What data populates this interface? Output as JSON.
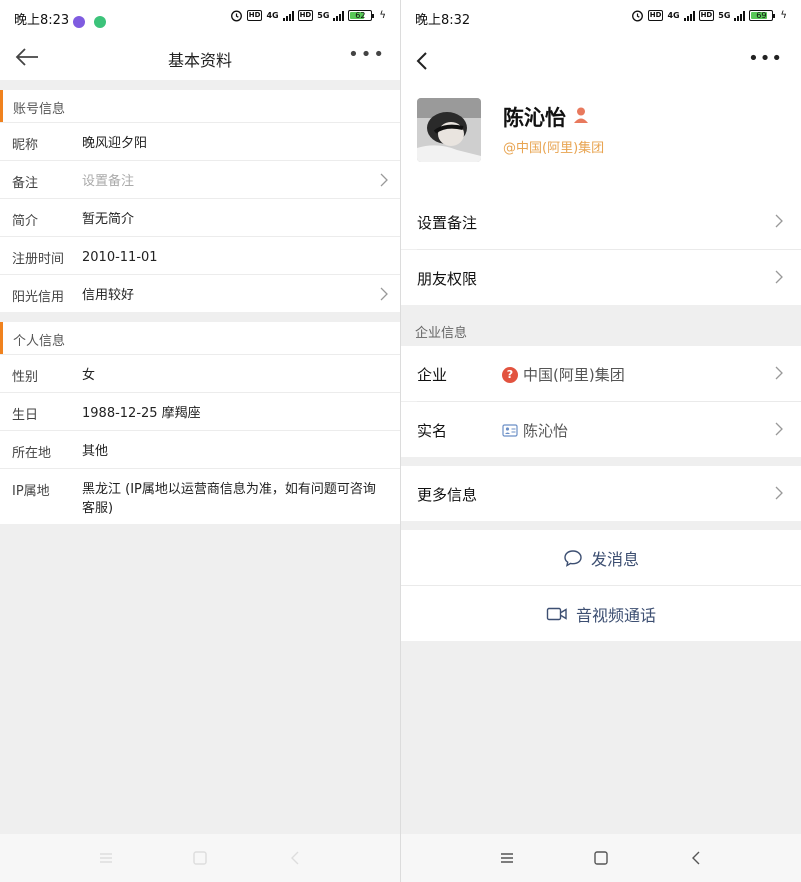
{
  "left": {
    "status": {
      "time": "晚上8:23",
      "battery": "62"
    },
    "header": {
      "title": "基本资料"
    },
    "account_section": {
      "title": "账号信息",
      "rows": [
        {
          "label": "昵称",
          "value": "晚风迎夕阳"
        },
        {
          "label": "备注",
          "value": "设置备注"
        },
        {
          "label": "简介",
          "value": "暂无简介"
        },
        {
          "label": "注册时间",
          "value": "2010-11-01"
        },
        {
          "label": "阳光信用",
          "value": "信用较好"
        }
      ]
    },
    "personal_section": {
      "title": "个人信息",
      "rows": [
        {
          "label": "性别",
          "value": "女"
        },
        {
          "label": "生日",
          "value": "1988-12-25 摩羯座"
        },
        {
          "label": "所在地",
          "value": "其他"
        },
        {
          "label": "IP属地",
          "value": "黑龙江 (IP属地以运营商信息为准，如有问题可咨询客服)"
        }
      ]
    }
  },
  "right": {
    "status": {
      "time": "晚上8:32",
      "battery": "69"
    },
    "profile": {
      "name": "陈沁怡",
      "company": "@中国(阿里)集团"
    },
    "rows": {
      "remark": "设置备注",
      "permission": "朋友权限"
    },
    "enterprise_section": {
      "title": "企业信息",
      "company_label": "企业",
      "company_value": "中国(阿里)集团",
      "realname_label": "实名",
      "realname_value": "陈沁怡"
    },
    "more_info": "更多信息",
    "actions": {
      "message": "发消息",
      "call": "音视频通话"
    }
  },
  "colors": {
    "accent_orange": "#f0821e",
    "company_gold": "#e8a451",
    "action_blue": "#3d4f72"
  }
}
